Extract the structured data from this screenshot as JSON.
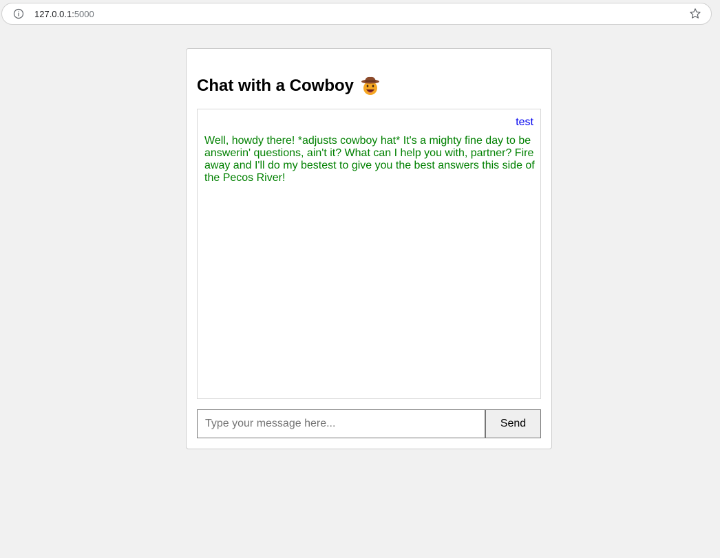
{
  "browser": {
    "url_host": "127.0.0.1:",
    "url_port": "5000",
    "info_icon": "info-circle-icon",
    "bookmark_icon": "star-outline-icon"
  },
  "chat": {
    "title": "Chat with a Cowboy",
    "title_icon": "cowboy-face-emoji-icon",
    "messages": [
      {
        "role": "user",
        "text": "test",
        "color": "#0000ee"
      },
      {
        "role": "bot",
        "text": "Well, howdy there! *adjusts cowboy hat* It's a mighty fine day to be answerin' questions, ain't it? What can I help you with, partner? Fire away and I'll do my bestest to give you the best answers this side of the Pecos River!",
        "color": "#008000"
      }
    ],
    "input_placeholder": "Type your message here...",
    "input_value": "",
    "send_label": "Send"
  },
  "colors": {
    "page_background": "#f1f1f1",
    "card_background": "#ffffff",
    "user_message": "#0000ee",
    "bot_message": "#008000"
  }
}
